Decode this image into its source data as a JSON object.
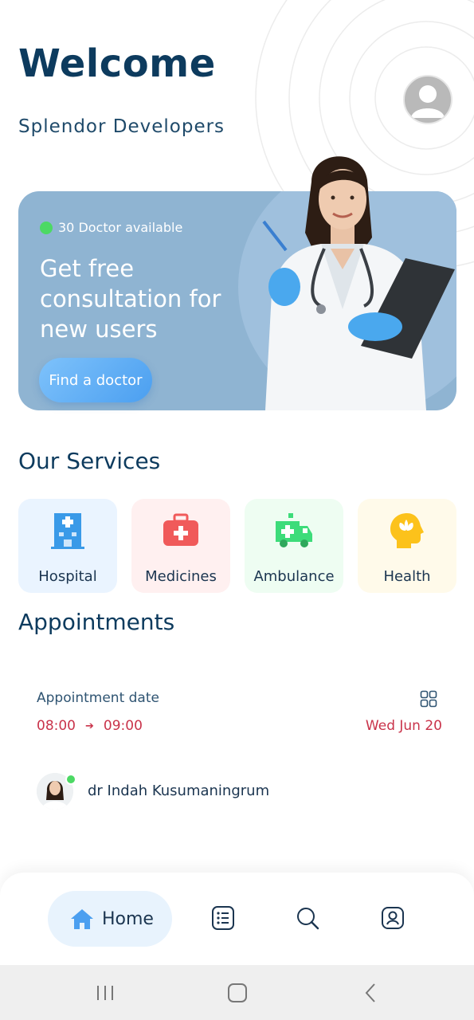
{
  "header": {
    "title": "Welcome",
    "subtitle": "Splendor Developers",
    "avatar_icon": "user-avatar-icon"
  },
  "banner": {
    "availability": "30 Doctor available",
    "headline": "Get free consultation for new users",
    "cta_label": "Find a doctor",
    "image": "doctor-photo"
  },
  "services": {
    "title": "Our Services",
    "items": [
      {
        "label": "Hospital",
        "icon": "hospital-icon",
        "bg": "#eaf4ff",
        "color": "#3a9ae8"
      },
      {
        "label": "Medicines",
        "icon": "medicine-kit-icon",
        "bg": "#fff0f0",
        "color": "#f05a5a"
      },
      {
        "label": "Ambulance",
        "icon": "ambulance-icon",
        "bg": "#eefdf2",
        "color": "#3ddc7a"
      },
      {
        "label": "Health",
        "icon": "mental-health-icon",
        "bg": "#fffaea",
        "color": "#fcc21b"
      }
    ]
  },
  "appointments": {
    "title": "Appointments",
    "date_label": "Appointment date",
    "start_time": "08:00",
    "end_time": "09:00",
    "date": "Wed Jun 20",
    "view_icon": "grid-view-icon",
    "doctor_name": "dr Indah Kusumaningrum"
  },
  "bottom_nav": {
    "home_label": "Home",
    "items": [
      "home-icon",
      "list-icon",
      "search-icon",
      "profile-icon"
    ]
  },
  "system_nav": [
    "recent-apps-icon",
    "home-button-icon",
    "back-icon"
  ],
  "colors": {
    "primary_text": "#0d3b5e",
    "accent_blue": "#4b9ff0",
    "banner_bg": "#8fb4d2",
    "appointment_red": "#c9334a",
    "online_green": "#4cd964"
  }
}
